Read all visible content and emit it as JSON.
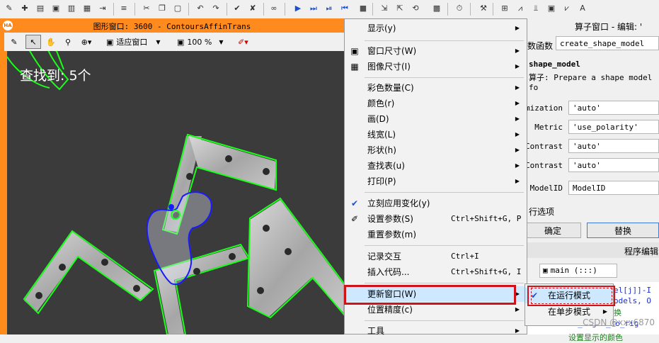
{
  "graphics_window": {
    "title": "图形窗口: 3600 - ContoursAffinTrans",
    "logo_text": "HA",
    "fit_window_label": "适应窗口",
    "zoom_label": "100 %",
    "found_text": "查找到: 5个"
  },
  "right_panel": {
    "header": "算子窗口 - 编辑: '",
    "function_label": "数函数",
    "function_value": "create_shape_model",
    "model_heading": "shape_model",
    "operator_desc": "算子: Prepare a shape model fo",
    "params": [
      {
        "label": "mization",
        "value": "'auto'"
      },
      {
        "label": "Metric",
        "value": "'use_polarity'"
      },
      {
        "label": "Contrast",
        "value": "'auto'"
      },
      {
        "label": "Contrast",
        "value": "'auto'"
      },
      {
        "label": "ModelID",
        "value": "ModelID"
      }
    ],
    "exec_options": "行选项",
    "ok_button": "确定",
    "replace_button": "替换",
    "program_editor": "程序编辑",
    "procedure_select": "main (:::)",
    "code_lines": [
      "el[j]]-I",
      "odels, O",
      "换",
      "te_angle_to_rig",
      "设置显示的颜色"
    ]
  },
  "context_menu": {
    "items": [
      {
        "label": "显示(y)",
        "submenu": true
      },
      {
        "label": "窗口尺寸(W)",
        "submenu": true,
        "icon": "window-size-icon"
      },
      {
        "label": "图像尺寸(I)",
        "submenu": true,
        "icon": "image-size-icon"
      },
      {
        "label": "彩色数量(C)",
        "submenu": true
      },
      {
        "label": "颜色(r)",
        "submenu": true
      },
      {
        "label": "画(D)",
        "submenu": true
      },
      {
        "label": "线宽(L)",
        "submenu": true
      },
      {
        "label": "形状(h)",
        "submenu": true
      },
      {
        "label": "查找表(u)",
        "submenu": true
      },
      {
        "label": "打印(P)",
        "submenu": true
      },
      {
        "label": "立刻应用变化(y)",
        "checked": true
      },
      {
        "label": "设置参数(S)",
        "shortcut": "Ctrl+Shift+G, P",
        "icon": "settings-icon"
      },
      {
        "label": "重置参数(m)"
      },
      {
        "label": "记录交互",
        "shortcut": "Ctrl+I"
      },
      {
        "label": "插入代码...",
        "shortcut": "Ctrl+Shift+G, I"
      },
      {
        "label": "更新窗口(W)",
        "submenu": true
      },
      {
        "label": "位置精度(c)",
        "submenu": true
      },
      {
        "label": "工具",
        "submenu": true
      }
    ]
  },
  "submenu": {
    "items": [
      {
        "label": "在运行模式",
        "checked": true
      },
      {
        "label": "在单步模式",
        "submenu": true
      }
    ]
  },
  "watermark": "CSDN @xxx6870",
  "colors": {
    "title_orange": "#ff8a1e",
    "highlight_red": "#d0121b",
    "contour_green": "#19ff19",
    "region_blue": "#1a1aff"
  }
}
